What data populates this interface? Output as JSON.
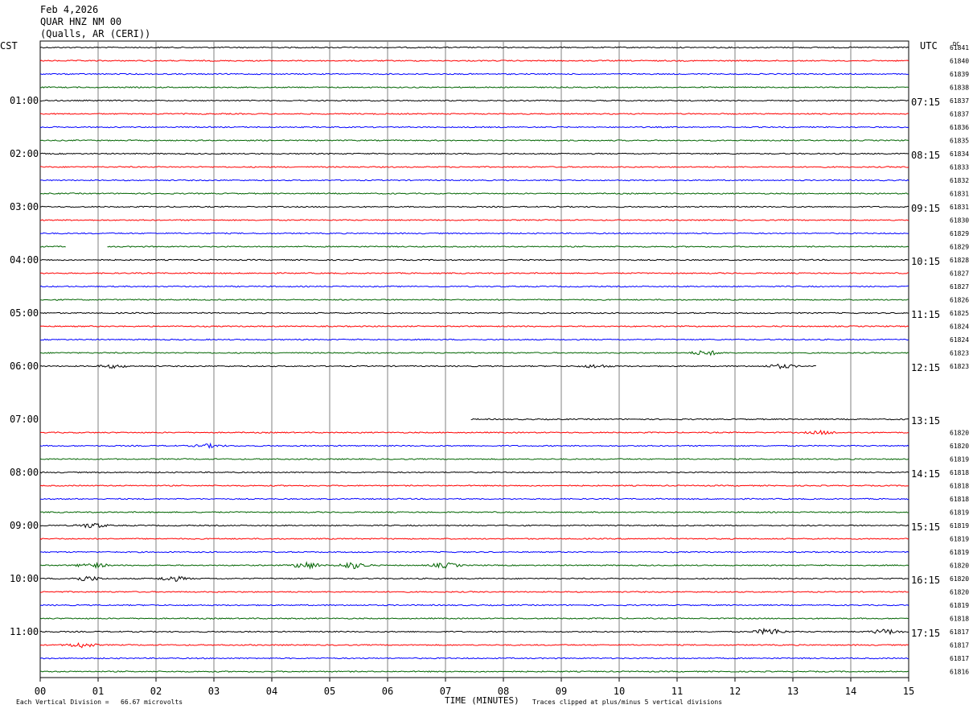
{
  "header": {
    "date": "Feb 4,2026",
    "station": "QUAR HNZ NM 00",
    "location": "(Qualls, AR (CERI))"
  },
  "labels": {
    "left_tz": "CST",
    "right_tz": "UTC",
    "dc": "DC"
  },
  "footer": {
    "scale_note": "Each Vertical Division =   66.67 microvolts",
    "xlabel": "TIME (MINUTES)",
    "clip_note": "Traces clipped at plus/minus 5 vertical divisions"
  },
  "colors": {
    "black": "#000000",
    "red": "#ff0000",
    "blue": "#0000ff",
    "green": "#006400",
    "grid": "#808080"
  },
  "chart_data": {
    "type": "line",
    "title": "QUAR HNZ NM 00",
    "xlabel": "TIME (MINUTES)",
    "xlim": [
      0,
      15
    ],
    "x_ticks": [
      "00",
      "01",
      "02",
      "03",
      "04",
      "05",
      "06",
      "07",
      "08",
      "09",
      "10",
      "11",
      "12",
      "13",
      "14",
      "15"
    ],
    "left_time_labels": [
      "01:00",
      "02:00",
      "03:00",
      "04:00",
      "05:00",
      "06:00",
      "07:00",
      "08:00",
      "09:00",
      "10:00",
      "11:00"
    ],
    "right_time_labels": [
      "07:15",
      "08:15",
      "09:15",
      "10:15",
      "11:15",
      "12:15",
      "13:15",
      "14:15",
      "15:15",
      "16:15",
      "17:15"
    ],
    "color_cycle": [
      "black",
      "red",
      "blue",
      "green"
    ],
    "trace_count": 48,
    "dc_values": [
      "61841",
      "61840",
      "61839",
      "61838",
      "61837",
      "61837",
      "61836",
      "61835",
      "61834",
      "61833",
      "61832",
      "61831",
      "61831",
      "61830",
      "61829",
      "61829",
      "61828",
      "61827",
      "61827",
      "61826",
      "61825",
      "61824",
      "61824",
      "61823",
      "61823",
      "",
      "",
      "",
      "",
      "61820",
      "61820",
      "61819",
      "61818",
      "61818",
      "61818",
      "61819",
      "61819",
      "61819",
      "61819",
      "61820",
      "61820",
      "61820",
      "61819",
      "61818",
      "61817",
      "61817",
      "61817",
      "61816"
    ],
    "gaps": [
      {
        "trace": 15,
        "from_min": 0.45,
        "to_min": 1.15
      },
      {
        "trace": 24,
        "from_min": 13.4,
        "to_min": 15
      },
      {
        "trace": 25,
        "from_min": 0,
        "to_min": 15
      },
      {
        "trace": 26,
        "from_min": 0,
        "to_min": 15
      },
      {
        "trace": 27,
        "from_min": 0,
        "to_min": 15
      },
      {
        "trace": 28,
        "from_min": 0,
        "to_min": 7.42
      }
    ],
    "events": [
      {
        "trace": 23,
        "at_min": 11.5,
        "amp": 3
      },
      {
        "trace": 24,
        "at_min": 1.25,
        "amp": 2
      },
      {
        "trace": 24,
        "at_min": 9.6,
        "amp": 2
      },
      {
        "trace": 24,
        "at_min": 12.8,
        "amp": 2.5
      },
      {
        "trace": 29,
        "at_min": 13.5,
        "amp": 2
      },
      {
        "trace": 30,
        "at_min": 2.9,
        "amp": 2
      },
      {
        "trace": 36,
        "at_min": 0.9,
        "amp": 3
      },
      {
        "trace": 39,
        "at_min": 0.9,
        "amp": 3
      },
      {
        "trace": 39,
        "at_min": 4.6,
        "amp": 4
      },
      {
        "trace": 39,
        "at_min": 5.4,
        "amp": 4
      },
      {
        "trace": 39,
        "at_min": 7.0,
        "amp": 3
      },
      {
        "trace": 40,
        "at_min": 0.8,
        "amp": 3
      },
      {
        "trace": 40,
        "at_min": 2.3,
        "amp": 3
      },
      {
        "trace": 44,
        "at_min": 12.6,
        "amp": 4
      },
      {
        "trace": 44,
        "at_min": 14.6,
        "amp": 3
      },
      {
        "trace": 45,
        "at_min": 0.7,
        "amp": 3
      }
    ]
  }
}
